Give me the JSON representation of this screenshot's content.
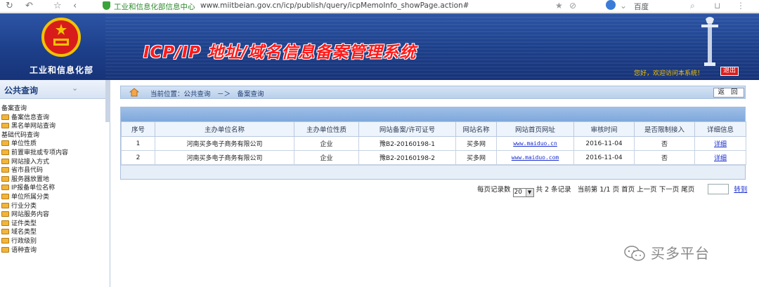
{
  "browser": {
    "site_name": "工业和信息化部信息中心",
    "url": "www.miitbeian.gov.cn/icp/publish/query/icpMemoInfo_showPage.action#",
    "search_engine": "百度"
  },
  "header": {
    "ministry": "工业和信息化部",
    "system_title": "ICP/IP 地址/域名信息备案管理系统",
    "welcome": "您好，欢迎访问本系统！",
    "logout_label": "退出"
  },
  "sidebar": {
    "title": "公共查询",
    "groups": [
      {
        "label": "备案查询",
        "items": [
          "备案信息查询",
          "黑名单网站查询"
        ]
      },
      {
        "label": "基础代码查询",
        "items": [
          "单位性质",
          "前置审批或专项内容",
          "网站接入方式",
          "省市县代码",
          "服务器放置地",
          "IP报备单位名称",
          "单位所属分类",
          "行业分类",
          "网站服务内容",
          "证件类型",
          "域名类型",
          "行政级别",
          "语种查询"
        ]
      }
    ]
  },
  "breadcrumb": {
    "text": "当前位置：公共查询　－＞　备案查询",
    "back_label": "返 回"
  },
  "table": {
    "headers": [
      "序号",
      "主办单位名称",
      "主办单位性质",
      "网站备案/许可证号",
      "网站名称",
      "网站首页网址",
      "审核时间",
      "是否限制接入",
      "详细信息"
    ],
    "rows": [
      {
        "no": "1",
        "org": "河南买多电子商务有限公司",
        "nature": "企业",
        "license": "豫B2-20160198-1",
        "site": "买多网",
        "url": "www.maiduo.cn",
        "date": "2016-11-04",
        "restricted": "否",
        "detail": "详细"
      },
      {
        "no": "2",
        "org": "河南买多电子商务有限公司",
        "nature": "企业",
        "license": "豫B2-20160198-2",
        "site": "买多网",
        "url": "www.maiduo.com",
        "date": "2016-11-04",
        "restricted": "否",
        "detail": "详细"
      }
    ]
  },
  "pager": {
    "per_page_label": "每页记录数",
    "per_page_value": "20",
    "total_text": "共 2 条记录",
    "current_text": "当前第 1/1 页",
    "first": "首页",
    "prev": "上一页",
    "next": "下一页",
    "last": "尾页",
    "goto": "转到"
  },
  "watermark": "买多平台"
}
